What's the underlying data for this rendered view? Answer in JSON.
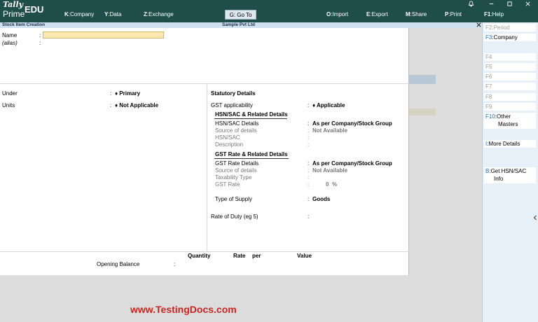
{
  "header": {
    "brand_top": "Tally",
    "brand_bottom": "Prime",
    "edition": "EDU",
    "menu": [
      {
        "key": "K",
        "label": ":Company"
      },
      {
        "key": "Y",
        "label": ":Data"
      },
      {
        "key": "Z",
        "label": ":Exchange"
      },
      {
        "key": "O",
        "label": ":Import"
      },
      {
        "key": "E",
        "label": ":Export"
      },
      {
        "key": "M",
        "label": ":Share"
      },
      {
        "key": "P",
        "label": ":Print"
      },
      {
        "key": "F1",
        "label": ":Help"
      }
    ],
    "goto": "G: Go To"
  },
  "title": {
    "screen": "Stock Item Creation",
    "company": "Sample Pvt Ltd"
  },
  "form": {
    "name_label": "Name",
    "name_value": "",
    "alias_label": "(alias)",
    "colon": ":",
    "under_label": "Under",
    "under_value": "♦ Primary",
    "units_label": "Units",
    "units_value": "♦ Not Applicable",
    "statutory_title": "Statutory Details",
    "gst_applicability_label": "GST applicability",
    "gst_applicability_value": "♦ Applicable",
    "hsn_section": "HSN/SAC & Related Details",
    "hsn_details_label": "HSN/SAC Details",
    "hsn_details_value": "As per Company/Stock Group",
    "hsn_source_label": "Source of details",
    "hsn_source_value": "Not Available",
    "hsn_label": "HSN/SAC",
    "description_label": "Description",
    "gst_rate_section": "GST Rate & Related Details",
    "gst_rate_details_label": "GST Rate Details",
    "gst_rate_details_value": "As per Company/Stock Group",
    "gst_source_label": "Source of details",
    "gst_source_value": "Not Available",
    "taxability_label": "Taxability Type",
    "gst_rate_label": "GST Rate",
    "gst_rate_value": "0",
    "percent": "%",
    "supply_label": "Type of Supply",
    "supply_value": "Goods",
    "duty_label": "Rate of Duty (eg 5)",
    "col_quantity": "Quantity",
    "col_rate": "Rate",
    "col_per": "per",
    "col_value": "Value",
    "opening_label": "Opening Balance"
  },
  "right_panel": [
    {
      "key": "F2",
      "label": ":Period",
      "dim": true
    },
    {
      "key": "F3",
      "label": ":Company",
      "dim": false
    },
    {
      "key": "F4",
      "label": "",
      "dim": true
    },
    {
      "key": "F5",
      "label": "",
      "dim": true
    },
    {
      "key": "F6",
      "label": "",
      "dim": true
    },
    {
      "key": "F7",
      "label": "",
      "dim": true
    },
    {
      "key": "F8",
      "label": "",
      "dim": true
    },
    {
      "key": "F9",
      "label": "",
      "dim": true
    },
    {
      "key": "F10",
      "label": ":Other",
      "label2": "Masters",
      "dim": false
    },
    {
      "key": "I",
      "label": ":More Details",
      "dim": false
    },
    {
      "key": "B",
      "label": ":Get HSN/SAC",
      "label2": "Info",
      "dim": false
    }
  ],
  "watermark": "www.TestingDocs.com",
  "icons": {
    "bell": "bell-icon",
    "minimize": "minimize-icon",
    "maximize": "maximize-icon",
    "close": "close-icon",
    "collapse": "chevron-left-icon"
  }
}
